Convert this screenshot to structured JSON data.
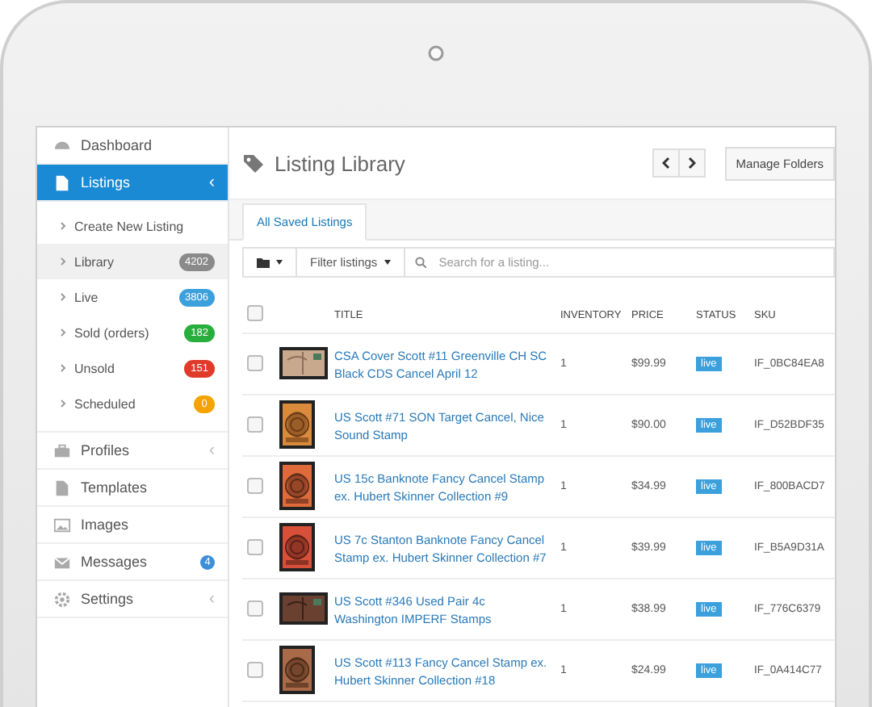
{
  "sidebar": {
    "items": [
      {
        "label": "Dashboard",
        "selected": false
      },
      {
        "label": "Listings",
        "selected": true,
        "chevron": "‹",
        "children": [
          {
            "label": "Create New Listing",
            "selected": false
          },
          {
            "label": "Library",
            "selected": true,
            "count": "4202",
            "color": "#8a8a8a"
          },
          {
            "label": "Live",
            "selected": false,
            "count": "3806",
            "color": "#3ca0dc"
          },
          {
            "label": "Sold (orders)",
            "selected": false,
            "count": "182",
            "color": "#27ae3c"
          },
          {
            "label": "Unsold",
            "selected": false,
            "count": "151",
            "color": "#e03a2a"
          },
          {
            "label": "Scheduled",
            "selected": false,
            "count": "0",
            "color": "#f5a300"
          }
        ]
      },
      {
        "label": "Profiles",
        "selected": false,
        "chevron": "‹"
      },
      {
        "label": "Templates",
        "selected": false
      },
      {
        "label": "Images",
        "selected": false
      },
      {
        "label": "Messages",
        "selected": false,
        "count": "4",
        "color": "#3c8fd8"
      },
      {
        "label": "Settings",
        "selected": false,
        "chevron": "‹"
      }
    ]
  },
  "header": {
    "title": "Listing Library",
    "manage_button": "Manage Folders"
  },
  "tabs": [
    {
      "label": "All Saved Listings",
      "selected": true
    }
  ],
  "toolbar": {
    "filter": "Filter listings",
    "search_placeholder": "Search for a listing..."
  },
  "table": {
    "select_all_checked": false,
    "columns": [
      "TITLE",
      "INVENTORY",
      "PRICE",
      "STATUS",
      "SKU"
    ],
    "rows": [
      {
        "checked": false,
        "title": "CSA Cover Scott #11 Greenville CH SC Black CDS Cancel April 12",
        "inventory": "1",
        "price": "$99.99",
        "status": "live",
        "sku": "IF_0BC84EA8"
      },
      {
        "checked": false,
        "title": "US Scott #71 SON Target Cancel, Nice Sound Stamp",
        "inventory": "1",
        "price": "$90.00",
        "status": "live",
        "sku": "IF_D52BDF35"
      },
      {
        "checked": false,
        "title": "US 15c Banknote Fancy Cancel Stamp ex. Hubert Skinner Collection #9",
        "inventory": "1",
        "price": "$34.99",
        "status": "live",
        "sku": "IF_800BACD7"
      },
      {
        "checked": false,
        "title": "US 7c Stanton Banknote Fancy Cancel Stamp ex. Hubert Skinner Collection #7",
        "inventory": "1",
        "price": "$39.99",
        "status": "live",
        "sku": "IF_B5A9D31A"
      },
      {
        "checked": false,
        "title": "US Scott #346 Used Pair 4c Washington IMPERF Stamps",
        "inventory": "1",
        "price": "$38.99",
        "status": "live",
        "sku": "IF_776C6379"
      },
      {
        "checked": false,
        "title": "US Scott #113 Fancy Cancel Stamp ex. Hubert Skinner Collection #18",
        "inventory": "1",
        "price": "$24.99",
        "status": "live",
        "sku": "IF_0A414C77"
      }
    ]
  }
}
